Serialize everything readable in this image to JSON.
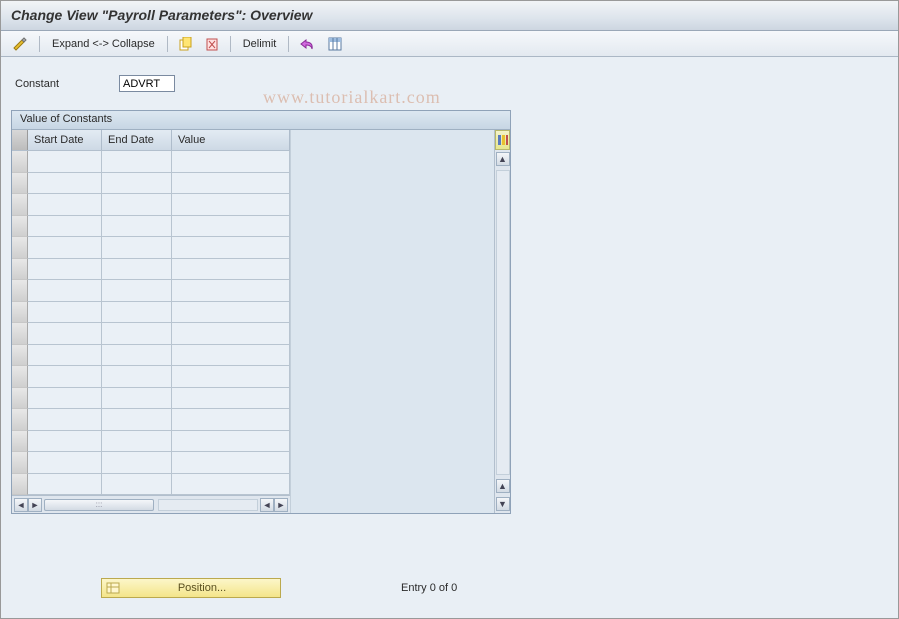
{
  "header": {
    "title": "Change View \"Payroll Parameters\": Overview"
  },
  "toolbar": {
    "expand_collapse_label": "Expand <-> Collapse",
    "delimit_label": "Delimit"
  },
  "field": {
    "label": "Constant",
    "value": "ADVRT"
  },
  "panel": {
    "title": "Value of Constants",
    "columns": {
      "c1": "Start Date",
      "c2": "End Date",
      "c3": "Value"
    },
    "row_count": 16
  },
  "footer": {
    "position_label": "Position...",
    "entry_label": "Entry 0 of 0"
  },
  "watermark": "www.tutorialkart.com"
}
